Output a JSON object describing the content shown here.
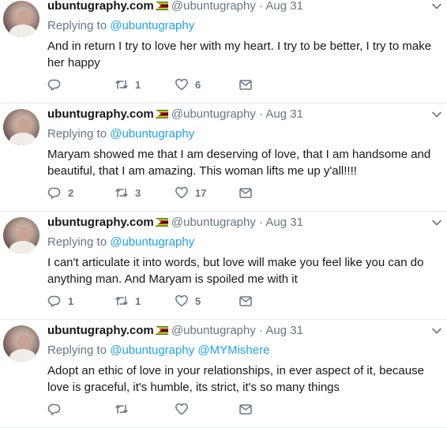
{
  "tweets": [
    {
      "name": "ubuntugraphy.com",
      "handle": "@ubuntugraphy",
      "dot": "·",
      "date": "Aug 31",
      "replying_prefix": "Replying to",
      "replying_to": [
        "@ubuntugraphy"
      ],
      "text": "And in return I try to love her with my heart. I try to be better, I try to make her happy",
      "replies": "",
      "retweets": "1",
      "likes": "6"
    },
    {
      "name": "ubuntugraphy.com",
      "handle": "@ubuntugraphy",
      "dot": "·",
      "date": "Aug 31",
      "replying_prefix": "Replying to",
      "replying_to": [
        "@ubuntugraphy"
      ],
      "text": "Maryam showed me that I am deserving of love, that I am handsome and beautiful, that I am amazing. This woman lifts me up y'all!!!!",
      "replies": "2",
      "retweets": "3",
      "likes": "17"
    },
    {
      "name": "ubuntugraphy.com",
      "handle": "@ubuntugraphy",
      "dot": "·",
      "date": "Aug 31",
      "replying_prefix": "Replying to",
      "replying_to": [
        "@ubuntugraphy"
      ],
      "text": "I can't articulate it into words, but love will make you feel like you can do anything man. And Maryam is spoiled me with it",
      "replies": "1",
      "retweets": "1",
      "likes": "5"
    },
    {
      "name": "ubuntugraphy.com",
      "handle": "@ubuntugraphy",
      "dot": "·",
      "date": "Aug 31",
      "replying_prefix": "Replying to",
      "replying_to": [
        "@ubuntugraphy",
        "@MYMishere"
      ],
      "text": "Adopt an ethic of love in your relationships, in ever aspect of it, because love is graceful, it's humble, its strict, it's so many things",
      "replies": "",
      "retweets": "",
      "likes": ""
    }
  ],
  "icons": {
    "reply": "reply-icon",
    "retweet": "retweet-icon",
    "like": "heart-icon",
    "message": "envelope-icon",
    "more": "chevron-down-icon"
  },
  "colors": {
    "link": "#1da1f2",
    "muted": "#657786",
    "text": "#14171a",
    "divider": "#e6ecf0"
  }
}
